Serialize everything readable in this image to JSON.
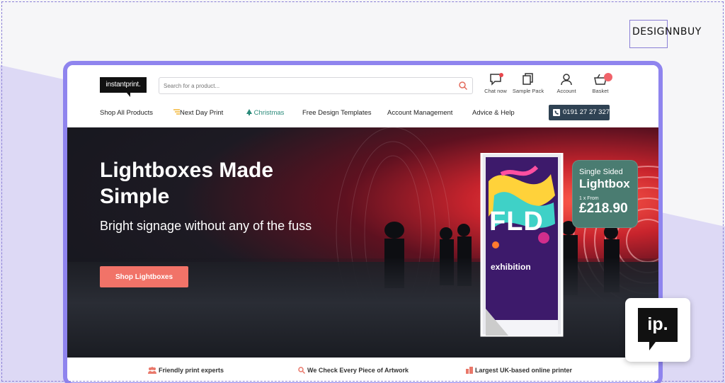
{
  "watermark": {
    "brand": "DESIGNNBUY"
  },
  "header": {
    "logo": "instantprint.",
    "search": {
      "placeholder": "Search for a product...",
      "value": ""
    },
    "icons": [
      {
        "icon": "chat-icon",
        "label": "Chat now"
      },
      {
        "icon": "sample-pack-icon",
        "label": "Sample Pack"
      },
      {
        "icon": "account-icon",
        "label": "Account"
      },
      {
        "icon": "basket-icon",
        "label": "Basket"
      }
    ]
  },
  "nav": {
    "items": [
      "Shop All Products",
      "Next Day Print",
      "Christmas",
      "Free Design Templates",
      "Account Management",
      "Advice & Help"
    ],
    "phone": "0191 27 27 327"
  },
  "hero": {
    "title": "Lightboxes Made Simple",
    "subtitle": "Bright signage without any of the fuss",
    "cta": "Shop Lightboxes",
    "badge": {
      "line1": "Single Sided",
      "line2": "Lightbox",
      "line3": "1 x From",
      "price": "£218.90"
    },
    "lightbox_text": {
      "main": "FLD",
      "sub": "exhibition"
    },
    "carousel": {
      "slides": 3,
      "active": 1
    }
  },
  "usps": [
    "Friendly print experts",
    "We Check Every Piece of Artwork",
    "Largest UK-based online printer"
  ],
  "badge_tile": {
    "text": "ip."
  },
  "colors": {
    "accent": "#8f84ee",
    "cta": "#f17368",
    "phone_bg": "#2f4253",
    "badge_bg": "#4a7c71",
    "christmas": "#2a8a7a"
  }
}
